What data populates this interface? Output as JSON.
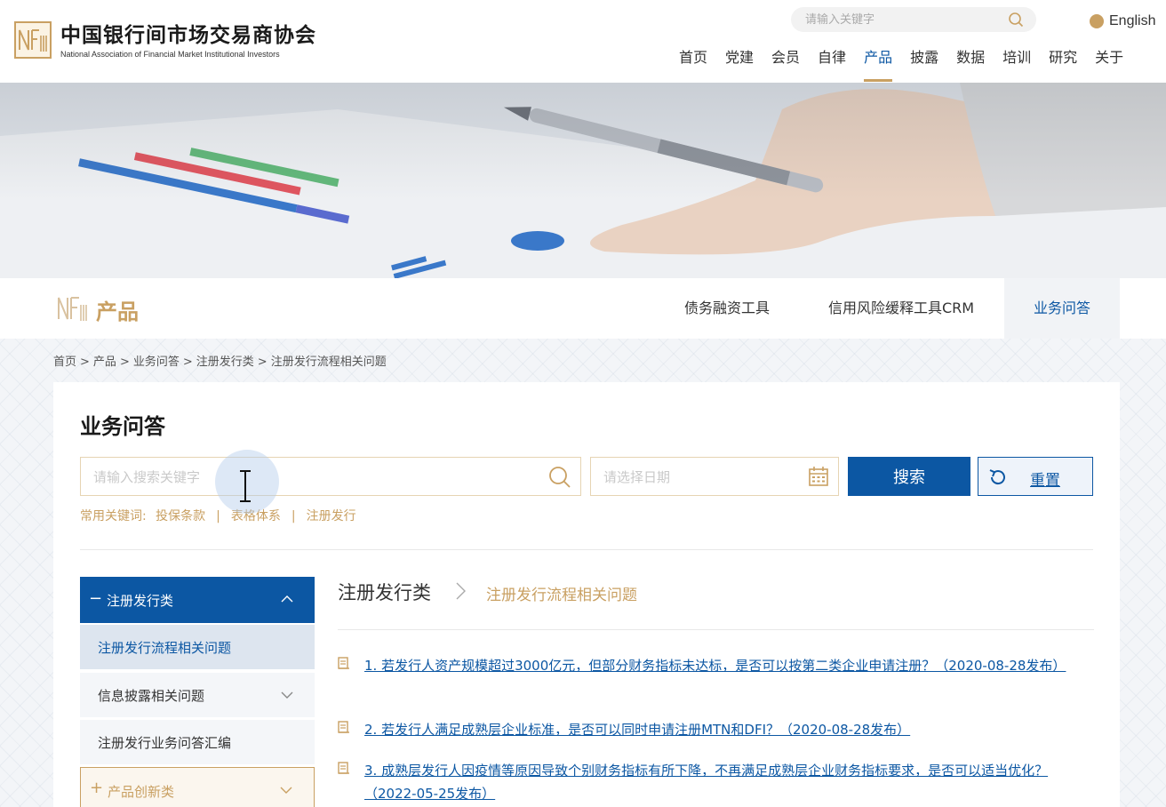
{
  "header": {
    "org_name_cn": "中国银行间市场交易商协会",
    "org_name_en": "National Association of Financial Market Institutional Investors",
    "search_placeholder": "请输入关键字",
    "language": "English",
    "nav": [
      "首页",
      "党建",
      "会员",
      "自律",
      "产品",
      "披露",
      "数据",
      "培训",
      "研究",
      "关于"
    ],
    "active_nav": "产品"
  },
  "section": {
    "title": "产品",
    "tabs": [
      "债务融资工具",
      "信用风险缓释工具CRM",
      "业务问答"
    ],
    "active_tab": "业务问答"
  },
  "breadcrumb": [
    "首页",
    "产品",
    "业务问答",
    "注册发行类",
    "注册发行流程相关问题"
  ],
  "search_panel": {
    "title": "业务问答",
    "keyword_placeholder": "请输入搜索关键字",
    "date_placeholder": "请选择日期",
    "search_button": "搜索",
    "reset_button": "重置",
    "hot_keywords_label": "常用关键词:",
    "hot_keywords": [
      "投保条款",
      "表格体系",
      "注册发行"
    ]
  },
  "sidebar": {
    "group_title": "注册发行类",
    "items": [
      "注册发行流程相关问题",
      "信息披露相关问题",
      "注册发行业务问答汇编"
    ],
    "selected_item": "注册发行流程相关问题",
    "next_group": "产品创新类"
  },
  "content": {
    "category": "注册发行类",
    "subcategory": "注册发行流程相关问题",
    "questions": [
      "1. 若发行人资产规模超过3000亿元，但部分财务指标未达标，是否可以按第二类企业申请注册？（2020-08-28发布）",
      "2. 若发行人满足成熟层企业标准，是否可以同时申请注册MTN和DFI？（2020-08-28发布）",
      "3. 成熟层发行人因疫情等原因导致个别财务指标有所下降，不再满足成熟层企业财务指标要求，是否可以适当优化？（2022-05-25发布）"
    ]
  },
  "colors": {
    "primary": "#0c57a3",
    "accent_gold": "#c9a062"
  }
}
